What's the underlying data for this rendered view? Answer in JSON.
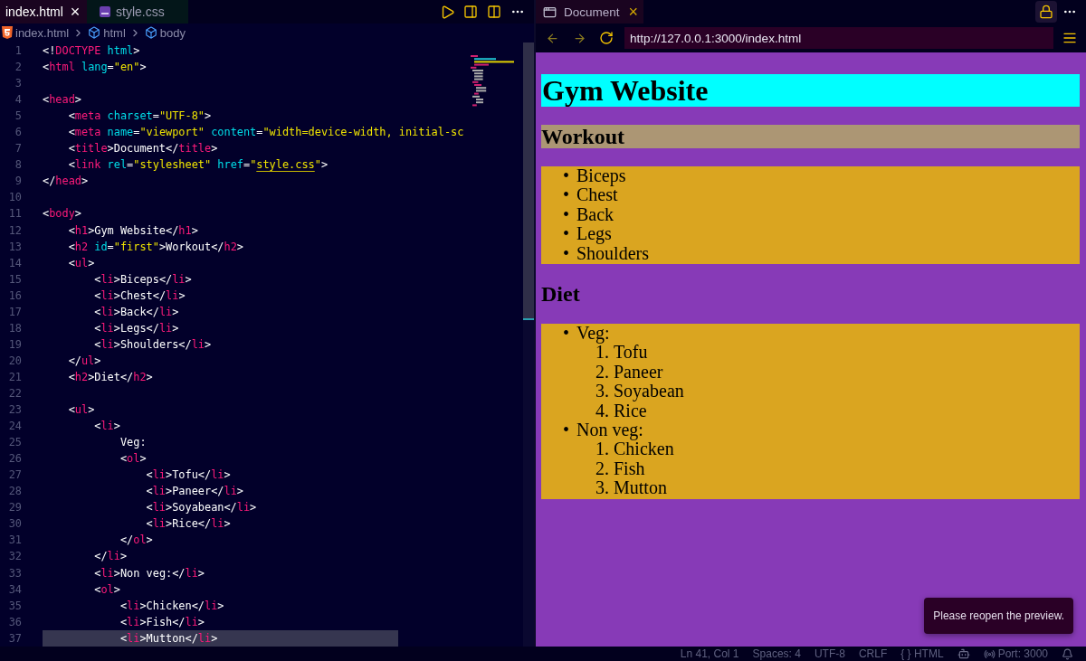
{
  "editor": {
    "tabs": [
      {
        "label": "index.html",
        "kind": "html",
        "selected": true,
        "close": "×"
      },
      {
        "label": "style.css",
        "kind": "css",
        "selected": false
      }
    ],
    "breadcrumb": [
      {
        "label": "index.html",
        "kind": "html"
      },
      {
        "label": "html",
        "kind": "element"
      },
      {
        "label": "body",
        "kind": "element"
      }
    ],
    "lines": [
      {
        "number": "1",
        "selected": false,
        "tokens": [
          {
            "kind": "punct",
            "text": "<!"
          },
          {
            "kind": "tag",
            "text": "DOCTYPE"
          },
          {
            "kind": "attr",
            "text": " html"
          },
          {
            "kind": "punct",
            "text": ">"
          }
        ]
      },
      {
        "number": "2",
        "selected": false,
        "tokens": [
          {
            "kind": "punct",
            "text": "<"
          },
          {
            "kind": "tag",
            "text": "html"
          },
          {
            "kind": "attr",
            "text": " lang"
          },
          {
            "kind": "punct",
            "text": "="
          },
          {
            "kind": "string",
            "text": "\"en\""
          },
          {
            "kind": "punct",
            "text": ">"
          }
        ]
      },
      {
        "number": "3",
        "selected": false
      },
      {
        "number": "4",
        "selected": false,
        "tokens": [
          {
            "kind": "punct",
            "text": "<"
          },
          {
            "kind": "tag",
            "text": "head"
          },
          {
            "kind": "punct",
            "text": ">"
          }
        ]
      },
      {
        "number": "5",
        "selected": false,
        "tokens": [
          {
            "kind": "punct",
            "text": "    <"
          },
          {
            "kind": "tag",
            "text": "meta"
          },
          {
            "kind": "attr",
            "text": " charset"
          },
          {
            "kind": "punct",
            "text": "="
          },
          {
            "kind": "string",
            "text": "\"UTF-8\""
          },
          {
            "kind": "punct",
            "text": ">"
          }
        ]
      },
      {
        "number": "6",
        "selected": false,
        "tokens": [
          {
            "kind": "punct",
            "text": "    <"
          },
          {
            "kind": "tag",
            "text": "meta"
          },
          {
            "kind": "attr",
            "text": " name"
          },
          {
            "kind": "punct",
            "text": "="
          },
          {
            "kind": "string",
            "text": "\"viewport\""
          },
          {
            "kind": "attr",
            "text": " content"
          },
          {
            "kind": "punct",
            "text": "="
          },
          {
            "kind": "string",
            "text": "\"width=device-width, initial-sc"
          }
        ]
      },
      {
        "number": "7",
        "selected": false,
        "tokens": [
          {
            "kind": "punct",
            "text": "    <"
          },
          {
            "kind": "tag",
            "text": "title"
          },
          {
            "kind": "punct",
            "text": ">Document</"
          },
          {
            "kind": "tag",
            "text": "title"
          },
          {
            "kind": "punct",
            "text": ">"
          }
        ]
      },
      {
        "number": "8",
        "selected": false,
        "tokens": [
          {
            "kind": "punct",
            "text": "    <"
          },
          {
            "kind": "tag",
            "text": "link"
          },
          {
            "kind": "attr",
            "text": " rel"
          },
          {
            "kind": "punct",
            "text": "="
          },
          {
            "kind": "string",
            "text": "\"stylesheet\""
          },
          {
            "kind": "attr",
            "text": " href"
          },
          {
            "kind": "punct",
            "text": "="
          },
          {
            "kind": "string",
            "text": "\""
          },
          {
            "kind": "link",
            "text": "style.css"
          },
          {
            "kind": "string",
            "text": "\""
          },
          {
            "kind": "punct",
            "text": ">"
          }
        ]
      },
      {
        "number": "9",
        "selected": false,
        "tokens": [
          {
            "kind": "punct",
            "text": "</"
          },
          {
            "kind": "tag",
            "text": "head"
          },
          {
            "kind": "punct",
            "text": ">"
          }
        ]
      },
      {
        "number": "10",
        "selected": false
      },
      {
        "number": "11",
        "selected": false,
        "tokens": [
          {
            "kind": "punct",
            "text": "<"
          },
          {
            "kind": "tag",
            "text": "body"
          },
          {
            "kind": "punct",
            "text": ">"
          }
        ]
      },
      {
        "number": "12",
        "selected": false,
        "tokens": [
          {
            "kind": "punct",
            "text": "    <"
          },
          {
            "kind": "tag",
            "text": "h1"
          },
          {
            "kind": "punct",
            "text": ">Gym Website</"
          },
          {
            "kind": "tag",
            "text": "h1"
          },
          {
            "kind": "punct",
            "text": ">"
          }
        ]
      },
      {
        "number": "13",
        "selected": false,
        "tokens": [
          {
            "kind": "punct",
            "text": "    <"
          },
          {
            "kind": "tag",
            "text": "h2"
          },
          {
            "kind": "attr",
            "text": " id"
          },
          {
            "kind": "punct",
            "text": "="
          },
          {
            "kind": "string",
            "text": "\"first\""
          },
          {
            "kind": "punct",
            "text": ">Workout</"
          },
          {
            "kind": "tag",
            "text": "h2"
          },
          {
            "kind": "punct",
            "text": ">"
          }
        ]
      },
      {
        "number": "14",
        "selected": false,
        "tokens": [
          {
            "kind": "punct",
            "text": "    <"
          },
          {
            "kind": "tag",
            "text": "ul"
          },
          {
            "kind": "punct",
            "text": ">"
          }
        ]
      },
      {
        "number": "15",
        "selected": false,
        "tokens": [
          {
            "kind": "punct",
            "text": "        <"
          },
          {
            "kind": "tag",
            "text": "li"
          },
          {
            "kind": "punct",
            "text": ">Biceps</"
          },
          {
            "kind": "tag",
            "text": "li"
          },
          {
            "kind": "punct",
            "text": ">"
          }
        ]
      },
      {
        "number": "16",
        "selected": false,
        "tokens": [
          {
            "kind": "punct",
            "text": "        <"
          },
          {
            "kind": "tag",
            "text": "li"
          },
          {
            "kind": "punct",
            "text": ">Chest</"
          },
          {
            "kind": "tag",
            "text": "li"
          },
          {
            "kind": "punct",
            "text": ">"
          }
        ]
      },
      {
        "number": "17",
        "selected": false,
        "tokens": [
          {
            "kind": "punct",
            "text": "        <"
          },
          {
            "kind": "tag",
            "text": "li"
          },
          {
            "kind": "punct",
            "text": ">Back</"
          },
          {
            "kind": "tag",
            "text": "li"
          },
          {
            "kind": "punct",
            "text": ">"
          }
        ]
      },
      {
        "number": "18",
        "selected": false,
        "tokens": [
          {
            "kind": "punct",
            "text": "        <"
          },
          {
            "kind": "tag",
            "text": "li"
          },
          {
            "kind": "punct",
            "text": ">Legs</"
          },
          {
            "kind": "tag",
            "text": "li"
          },
          {
            "kind": "punct",
            "text": ">"
          }
        ]
      },
      {
        "number": "19",
        "selected": false,
        "tokens": [
          {
            "kind": "punct",
            "text": "        <"
          },
          {
            "kind": "tag",
            "text": "li"
          },
          {
            "kind": "punct",
            "text": ">Shoulders</"
          },
          {
            "kind": "tag",
            "text": "li"
          },
          {
            "kind": "punct",
            "text": ">"
          }
        ]
      },
      {
        "number": "20",
        "selected": false,
        "tokens": [
          {
            "kind": "punct",
            "text": "    </"
          },
          {
            "kind": "tag",
            "text": "ul"
          },
          {
            "kind": "punct",
            "text": ">"
          }
        ]
      },
      {
        "number": "21",
        "selected": false,
        "tokens": [
          {
            "kind": "punct",
            "text": "    <"
          },
          {
            "kind": "tag",
            "text": "h2"
          },
          {
            "kind": "punct",
            "text": ">Diet</"
          },
          {
            "kind": "tag",
            "text": "h2"
          },
          {
            "kind": "punct",
            "text": ">"
          }
        ]
      },
      {
        "number": "22",
        "selected": false
      },
      {
        "number": "23",
        "selected": false,
        "tokens": [
          {
            "kind": "punct",
            "text": "    <"
          },
          {
            "kind": "tag",
            "text": "ul"
          },
          {
            "kind": "punct",
            "text": ">"
          }
        ]
      },
      {
        "number": "24",
        "selected": false,
        "tokens": [
          {
            "kind": "punct",
            "text": "        <"
          },
          {
            "kind": "tag",
            "text": "li"
          },
          {
            "kind": "punct",
            "text": ">"
          }
        ]
      },
      {
        "number": "25",
        "selected": false,
        "tokens": [
          {
            "kind": "punct",
            "text": "            Veg:"
          }
        ]
      },
      {
        "number": "26",
        "selected": false,
        "tokens": [
          {
            "kind": "punct",
            "text": "            <"
          },
          {
            "kind": "tag",
            "text": "ol"
          },
          {
            "kind": "punct",
            "text": ">"
          }
        ]
      },
      {
        "number": "27",
        "selected": false,
        "tokens": [
          {
            "kind": "punct",
            "text": "                <"
          },
          {
            "kind": "tag",
            "text": "li"
          },
          {
            "kind": "punct",
            "text": ">Tofu</"
          },
          {
            "kind": "tag",
            "text": "li"
          },
          {
            "kind": "punct",
            "text": ">"
          }
        ]
      },
      {
        "number": "28",
        "selected": false,
        "tokens": [
          {
            "kind": "punct",
            "text": "                <"
          },
          {
            "kind": "tag",
            "text": "li"
          },
          {
            "kind": "punct",
            "text": ">Paneer</"
          },
          {
            "kind": "tag",
            "text": "li"
          },
          {
            "kind": "punct",
            "text": ">"
          }
        ]
      },
      {
        "number": "29",
        "selected": false,
        "tokens": [
          {
            "kind": "punct",
            "text": "                <"
          },
          {
            "kind": "tag",
            "text": "li"
          },
          {
            "kind": "punct",
            "text": ">Soyabean</"
          },
          {
            "kind": "tag",
            "text": "li"
          },
          {
            "kind": "punct",
            "text": ">"
          }
        ]
      },
      {
        "number": "30",
        "selected": false,
        "tokens": [
          {
            "kind": "punct",
            "text": "                <"
          },
          {
            "kind": "tag",
            "text": "li"
          },
          {
            "kind": "punct",
            "text": ">Rice</"
          },
          {
            "kind": "tag",
            "text": "li"
          },
          {
            "kind": "punct",
            "text": ">"
          }
        ]
      },
      {
        "number": "31",
        "selected": false,
        "tokens": [
          {
            "kind": "punct",
            "text": "            </"
          },
          {
            "kind": "tag",
            "text": "ol"
          },
          {
            "kind": "punct",
            "text": ">"
          }
        ]
      },
      {
        "number": "32",
        "selected": false,
        "tokens": [
          {
            "kind": "punct",
            "text": "        </"
          },
          {
            "kind": "tag",
            "text": "li"
          },
          {
            "kind": "punct",
            "text": ">"
          }
        ]
      },
      {
        "number": "33",
        "selected": false,
        "tokens": [
          {
            "kind": "punct",
            "text": "        <"
          },
          {
            "kind": "tag",
            "text": "li"
          },
          {
            "kind": "punct",
            "text": ">Non veg:</"
          },
          {
            "kind": "tag",
            "text": "li"
          },
          {
            "kind": "punct",
            "text": ">"
          }
        ]
      },
      {
        "number": "34",
        "selected": false,
        "tokens": [
          {
            "kind": "punct",
            "text": "        <"
          },
          {
            "kind": "tag",
            "text": "ol"
          },
          {
            "kind": "punct",
            "text": ">"
          }
        ]
      },
      {
        "number": "35",
        "selected": false,
        "tokens": [
          {
            "kind": "punct",
            "text": "            <"
          },
          {
            "kind": "tag",
            "text": "li"
          },
          {
            "kind": "punct",
            "text": ">Chicken</"
          },
          {
            "kind": "tag",
            "text": "li"
          },
          {
            "kind": "punct",
            "text": ">"
          }
        ]
      },
      {
        "number": "36",
        "selected": false,
        "tokens": [
          {
            "kind": "punct",
            "text": "            <"
          },
          {
            "kind": "tag",
            "text": "li"
          },
          {
            "kind": "punct",
            "text": ">Fish</"
          },
          {
            "kind": "tag",
            "text": "li"
          },
          {
            "kind": "punct",
            "text": ">"
          }
        ]
      },
      {
        "number": "37",
        "selected": true,
        "tokens": [
          {
            "kind": "punct",
            "text": "            <"
          },
          {
            "kind": "tag",
            "text": "li"
          },
          {
            "kind": "punct",
            "text": ">Mutton</"
          },
          {
            "kind": "tag",
            "text": "li"
          },
          {
            "kind": "punct",
            "text": ">"
          }
        ]
      }
    ]
  },
  "preview": {
    "tab": {
      "label": "Document",
      "close": "×"
    },
    "url": "http://127.0.0.1:3000/index.html",
    "page": {
      "heading": "Gym Website",
      "sections": [
        {
          "title": "Workout",
          "highlighted": true,
          "items": [
            {
              "marker": "•",
              "label": "Biceps"
            },
            {
              "marker": "•",
              "label": "Chest"
            },
            {
              "marker": "•",
              "label": "Back"
            },
            {
              "marker": "•",
              "label": "Legs"
            },
            {
              "marker": "•",
              "label": "Shoulders"
            }
          ]
        },
        {
          "title": "Diet",
          "highlighted": false,
          "items": [
            {
              "marker": "•",
              "label": "Veg:",
              "children": [
                {
                  "marker": "1.",
                  "label": "Tofu"
                },
                {
                  "marker": "2.",
                  "label": "Paneer"
                },
                {
                  "marker": "3.",
                  "label": "Soyabean"
                },
                {
                  "marker": "4.",
                  "label": "Rice"
                }
              ]
            },
            {
              "marker": "•",
              "label": "Non veg:",
              "children": [
                {
                  "marker": "1.",
                  "label": "Chicken"
                },
                {
                  "marker": "2.",
                  "label": "Fish"
                },
                {
                  "marker": "3.",
                  "label": "Mutton"
                }
              ]
            }
          ]
        }
      ]
    },
    "toast": "Please reopen the preview."
  },
  "status_bar": [
    {
      "kind": "text",
      "label": "Ln 41, Col 1"
    },
    {
      "kind": "text",
      "label": "Spaces: 4"
    },
    {
      "kind": "text",
      "label": "UTF-8"
    },
    {
      "kind": "text",
      "label": "CRLF"
    },
    {
      "kind": "text",
      "label": "{ } HTML"
    },
    {
      "kind": "copilot"
    },
    {
      "kind": "port",
      "label": "Port: 3000"
    },
    {
      "kind": "bell"
    }
  ]
}
